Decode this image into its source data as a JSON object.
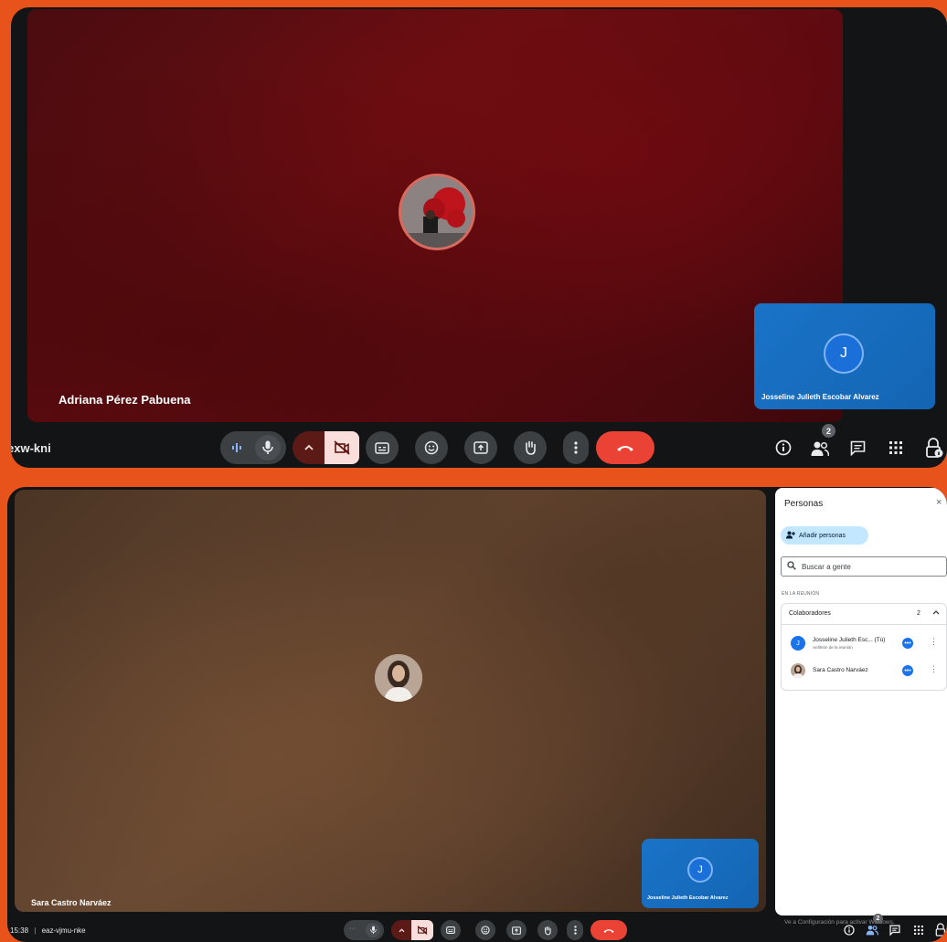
{
  "colors": {
    "frame": "#e8531c",
    "meet_dark": "#131416",
    "leave_red": "#ea4335",
    "camera_off_pink": "#f9dedc",
    "self_tile_blue": "#1a73c8",
    "accent_blue": "#1a73e8"
  },
  "top": {
    "main_participant": "Adriana Pérez Pabuena",
    "self_tile_initial": "J",
    "self_tile_name": "Josseline Julieth Escobar Alvarez",
    "meeting_code": "exw-kni",
    "people_badge": "2",
    "controls": [
      "audio-level-icon",
      "mic-icon",
      "chevron-up-icon",
      "camera-off-icon",
      "captions-icon",
      "emoji-icon",
      "present-icon",
      "raise-hand-icon",
      "more-vert-icon",
      "end-call-icon"
    ],
    "right_icons": [
      "info-icon",
      "people-icon",
      "chat-icon",
      "activities-icon",
      "lock-icon"
    ]
  },
  "bottom": {
    "main_participant": "Sara Castro Narváez",
    "self_tile_initial": "J",
    "self_tile_name": "Josseline Julieth Escobar Alvarez",
    "time": "15:38",
    "separator": "|",
    "meeting_code": "eaz-vjmu-nke",
    "people_badge": "2",
    "people_panel": {
      "title": "Personas",
      "close": "×",
      "add_button": "Añadir personas",
      "search_placeholder": "Buscar a gente",
      "section": "EN LA REUNIÓN",
      "group_name": "Colaboradores",
      "group_count": "2",
      "participants": [
        {
          "initial": "J",
          "name": "Josseline Julieth Esc... (Tú)",
          "role": "Anfitrión de la reunión"
        },
        {
          "initial": "",
          "name": "Sara Castro Narváez",
          "role": ""
        }
      ]
    },
    "watermark_title": "Activar Windows",
    "watermark_sub": "Ve a Configuración para activar Windows."
  }
}
